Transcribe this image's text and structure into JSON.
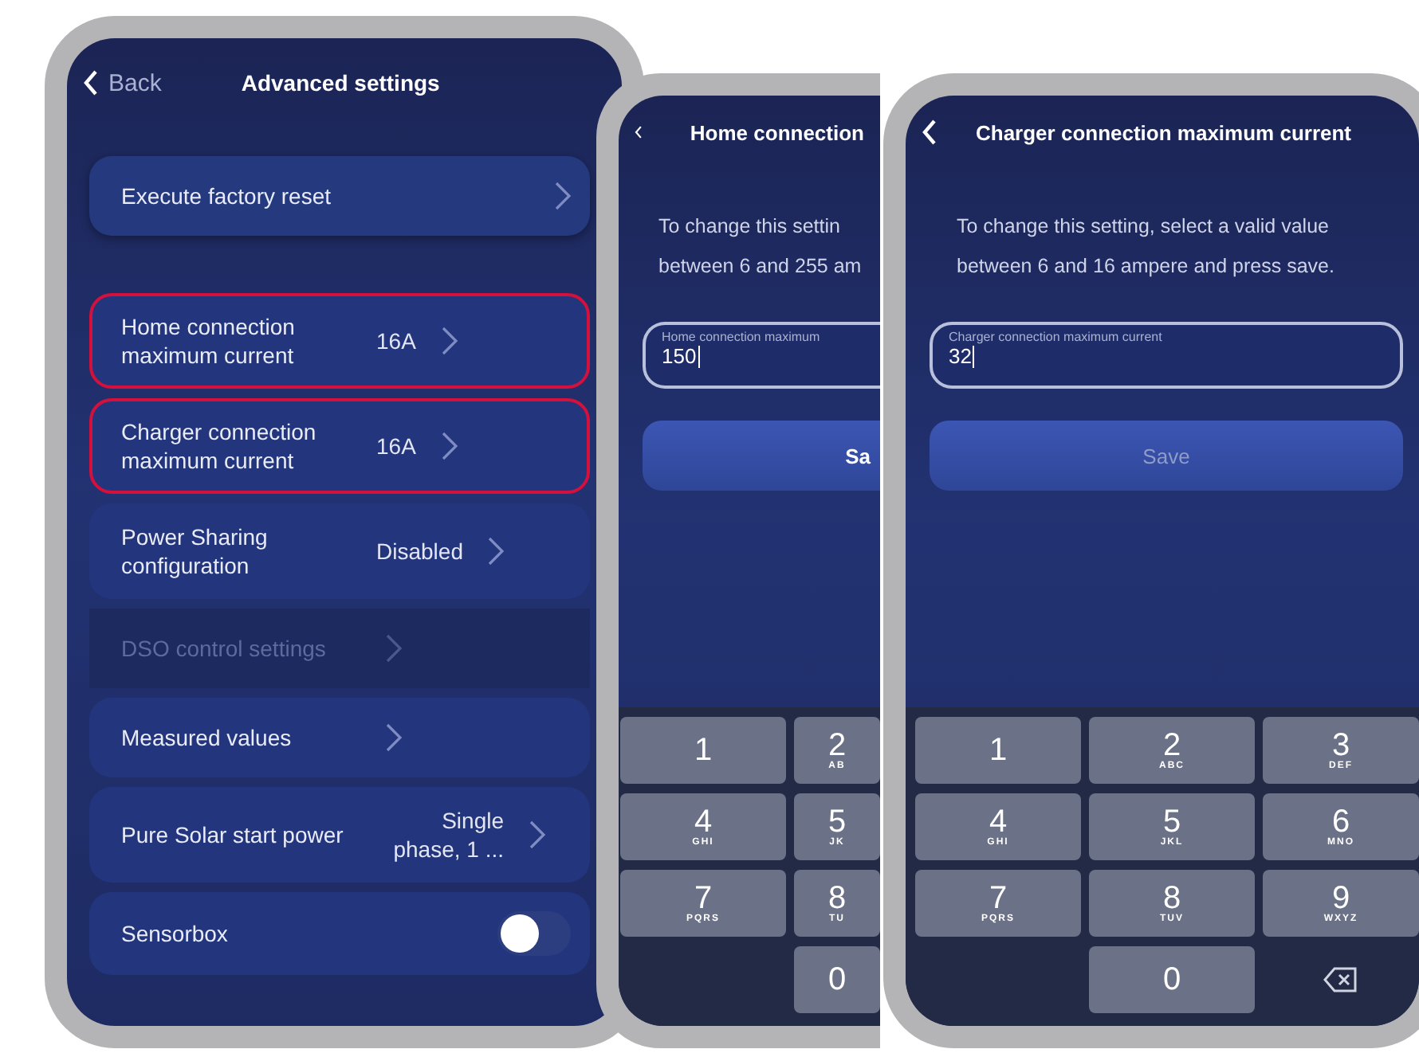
{
  "screens": [
    {
      "kind": "settings",
      "back_label": "Back",
      "title": "Advanced settings",
      "groups": [
        [
          {
            "kind": "link",
            "label": "Execute factory reset",
            "highlighted": false,
            "disabled": false
          }
        ],
        [
          {
            "kind": "link",
            "label": "Home connection maximum current",
            "value": "16A",
            "highlighted": true,
            "disabled": false
          },
          {
            "kind": "link",
            "label": "Charger connection maximum current",
            "value": "16A",
            "highlighted": true,
            "disabled": false
          },
          {
            "kind": "link",
            "label": "Power Sharing configuration",
            "value": "Disabled",
            "highlighted": false,
            "disabled": false
          },
          {
            "kind": "link",
            "label": "DSO control settings",
            "highlighted": false,
            "disabled": true
          },
          {
            "kind": "link",
            "label": "Measured values",
            "highlighted": false,
            "disabled": false
          },
          {
            "kind": "link",
            "label": "Pure Solar start power",
            "value": "Single phase, 1 ...",
            "highlighted": false,
            "disabled": false
          },
          {
            "kind": "toggle",
            "label": "Sensorbox",
            "on": false
          }
        ]
      ]
    },
    {
      "kind": "input",
      "title": "Home connection",
      "instructions": [
        "To change this settin",
        "between 6 and 255 am"
      ],
      "field": {
        "label": "Home connection maximum",
        "value": "150"
      },
      "save": {
        "label": "Sa",
        "disabled": false
      },
      "keypad": [
        [
          {
            "kind": "digit",
            "digit": "1"
          },
          {
            "kind": "digit",
            "digit": "2",
            "letters": "AB"
          }
        ],
        [
          {
            "kind": "digit",
            "digit": "4",
            "letters": "GHI"
          },
          {
            "kind": "digit",
            "digit": "5",
            "letters": "JK"
          }
        ],
        [
          {
            "kind": "digit",
            "digit": "7",
            "letters": "PQRS"
          },
          {
            "kind": "digit",
            "digit": "8",
            "letters": "TU"
          }
        ],
        [
          {
            "kind": "blank"
          },
          {
            "kind": "digit",
            "digit": "0"
          }
        ]
      ]
    },
    {
      "kind": "input",
      "title": "Charger connection maximum current",
      "instructions": [
        "To change this setting, select a valid value",
        "between 6 and 16 ampere and press save."
      ],
      "field": {
        "label": "Charger connection maximum current",
        "value": "32"
      },
      "save": {
        "label": "Save",
        "disabled": true
      },
      "keypad": [
        [
          {
            "kind": "digit",
            "digit": "1"
          },
          {
            "kind": "digit",
            "digit": "2",
            "letters": "ABC"
          },
          {
            "kind": "digit",
            "digit": "3",
            "letters": "DEF"
          }
        ],
        [
          {
            "kind": "digit",
            "digit": "4",
            "letters": "GHI"
          },
          {
            "kind": "digit",
            "digit": "5",
            "letters": "JKL"
          },
          {
            "kind": "digit",
            "digit": "6",
            "letters": "MNO"
          }
        ],
        [
          {
            "kind": "digit",
            "digit": "7",
            "letters": "PQRS"
          },
          {
            "kind": "digit",
            "digit": "8",
            "letters": "TUV"
          },
          {
            "kind": "digit",
            "digit": "9",
            "letters": "WXYZ"
          }
        ],
        [
          {
            "kind": "blank"
          },
          {
            "kind": "digit",
            "digit": "0"
          },
          {
            "kind": "backspace"
          }
        ]
      ]
    }
  ]
}
